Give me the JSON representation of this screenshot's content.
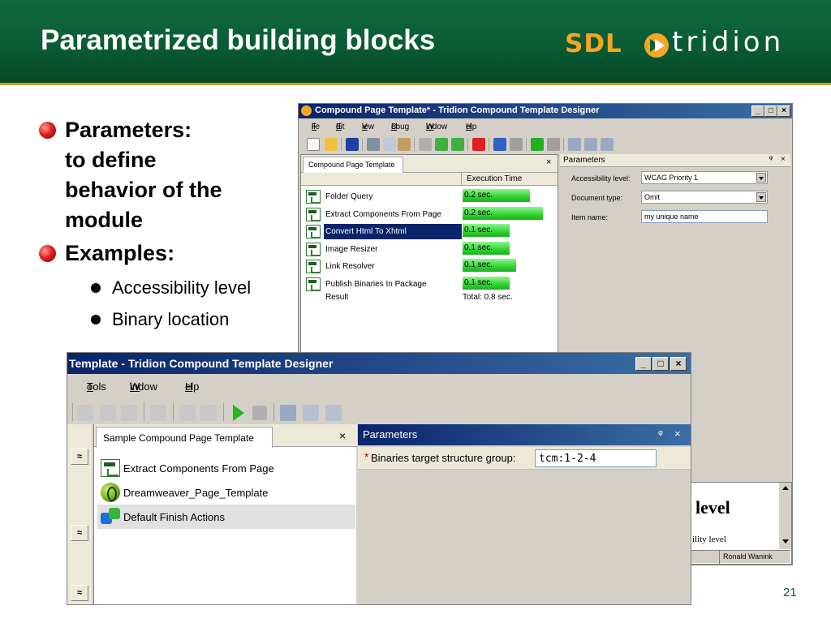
{
  "slide": {
    "title": "Parametrized building blocks",
    "logo": {
      "brand": "SDL",
      "product": "tridion"
    },
    "bullets": [
      {
        "text": "Parameters:",
        "line2": "to define",
        "line3": "behavior of the",
        "line4": "module"
      },
      {
        "text": "Examples:"
      }
    ],
    "sub_bullets": [
      "Accessibility level",
      "Binary location"
    ],
    "page_number": "21"
  },
  "colors": {
    "header_green": "#0a5a34",
    "gold_rule": "#c9a227",
    "logo_orange": "#f5a623",
    "bullet_red": "#e02020",
    "titlebar_blue": "#0a246a",
    "bar_green": "#2fd32f"
  },
  "window_small": {
    "title": "Compound Page Template* - Tridion Compound Template Designer",
    "menu": [
      {
        "key": "F",
        "rest": "ile"
      },
      {
        "key": "E",
        "rest": "dit"
      },
      {
        "key": "V",
        "rest": "iew"
      },
      {
        "key": "D",
        "rest": "ebug"
      },
      {
        "key": "W",
        "rest": "indow"
      },
      {
        "key": "H",
        "rest": "elp"
      }
    ],
    "tab_label": "Compound Page Template",
    "tab_close": "×",
    "column_header": "Execution Time",
    "rows": [
      {
        "name": "Folder Query",
        "time": "0.2 sec.",
        "fill": 0.75
      },
      {
        "name": "Extract Components From Page",
        "time": "0.2 sec.",
        "fill": 0.9
      },
      {
        "name": "Convert Html To Xhtml",
        "time": "0.1 sec.",
        "fill": 0.53,
        "selected": true
      },
      {
        "name": "Image Resizer",
        "time": "0.1 sec.",
        "fill": 0.53
      },
      {
        "name": "Link Resolver",
        "time": "0.1 sec.",
        "fill": 0.6
      },
      {
        "name": "Publish Binaries In Package",
        "time": "0.1 sec.",
        "fill": 0.53
      }
    ],
    "result_label": "Result",
    "result_total": "Total: 0.8 sec.",
    "params_title": "Parameters",
    "params_pin": "ᵠ",
    "params_close": "×",
    "params": [
      {
        "label": "Accessibility level:",
        "value": "WCAG Priority 1",
        "dropdown": true
      },
      {
        "label": "Document type:",
        "value": "Omit",
        "dropdown": true
      },
      {
        "label": "Item name:",
        "value": "my unique name",
        "dropdown": false
      }
    ],
    "preview_heading": "level",
    "preview_text": "ility level",
    "status_user": "Ronald Wanink"
  },
  "window_big": {
    "title": "Template - Tridion Compound Template Designer",
    "menu": [
      {
        "key": "T",
        "rest": "ools"
      },
      {
        "key": "W",
        "rest": "indow"
      },
      {
        "key": "H",
        "rest": "elp"
      }
    ],
    "tab_label": "Sample Compound Page Template",
    "tab_close": "×",
    "rows": [
      {
        "name": "Extract Components From Page",
        "icon": "template-icon"
      },
      {
        "name": "Dreamweaver_Page_Template",
        "icon": "dreamweaver-icon"
      },
      {
        "name": "Default Finish Actions",
        "icon": "puzzle-icon",
        "selected": true
      }
    ],
    "params_title": "Parameters",
    "params_pin": "ᵠ",
    "params_close": "×",
    "param_required_mark": "*",
    "param_label": "Binaries target structure group:",
    "param_value": "tcm:1-2-4",
    "chevron": "≈"
  }
}
